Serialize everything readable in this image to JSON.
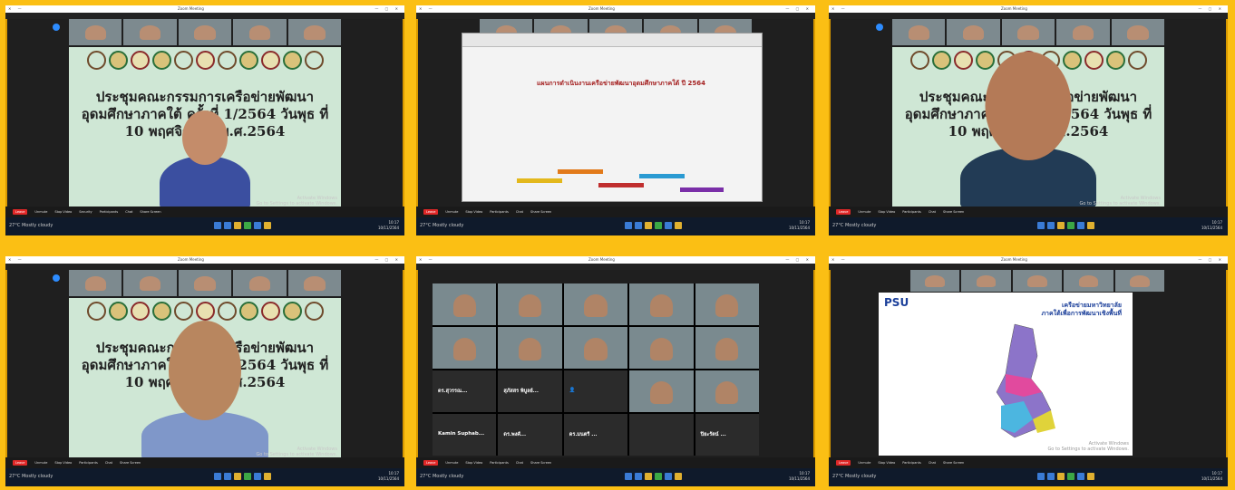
{
  "app": {
    "title": "Zoom Meeting",
    "window_controls": "— ▢ ✕",
    "left_controls": "✕ —"
  },
  "toolbar": {
    "leave": "Leave",
    "items": [
      "Unmute",
      "Stop Video",
      "Security",
      "Participants",
      "Chat",
      "Share Screen",
      "Record",
      "Reactions"
    ]
  },
  "activate": {
    "line1": "Activate Windows",
    "line2": "Go to Settings to activate Windows."
  },
  "taskbar": {
    "weather": "27°C  Mostly cloudy",
    "time": "10:17",
    "date": "10/11/2564"
  },
  "banner_text": "ประชุมคณะกรรมการเครือข่ายพัฒนาอุดมศึกษาภาคใต้ ครั้งที่ 1/2564 วันพุธ ที่ 10 พฤศจิกายน พ.ศ.2564",
  "slide": {
    "header": "แผนการดำเนินงานเครือข่ายพัฒนาอุดมศึกษาภาคใต้ ปี 2564"
  },
  "map": {
    "title_line1": "เครือข่ายมหาวิทยาลัย",
    "title_line2": "ภาคใต้เพื่อการพัฒนาเชิงพื้นที่",
    "logo": "PSU"
  },
  "grid_names": [
    "ดร.สุวรรณ...",
    "สุภัสสร พิบูลย์...",
    "ดร.ภัทร ...",
    "Kamin Suphab...",
    "ดร.พงศ์...",
    "ดร.มนตรี ...",
    "ปิยะรัตน์ ..."
  ],
  "colors": {
    "frame": "#fbbf14",
    "leave": "#e02828",
    "zoom_blue": "#2d8cff"
  }
}
